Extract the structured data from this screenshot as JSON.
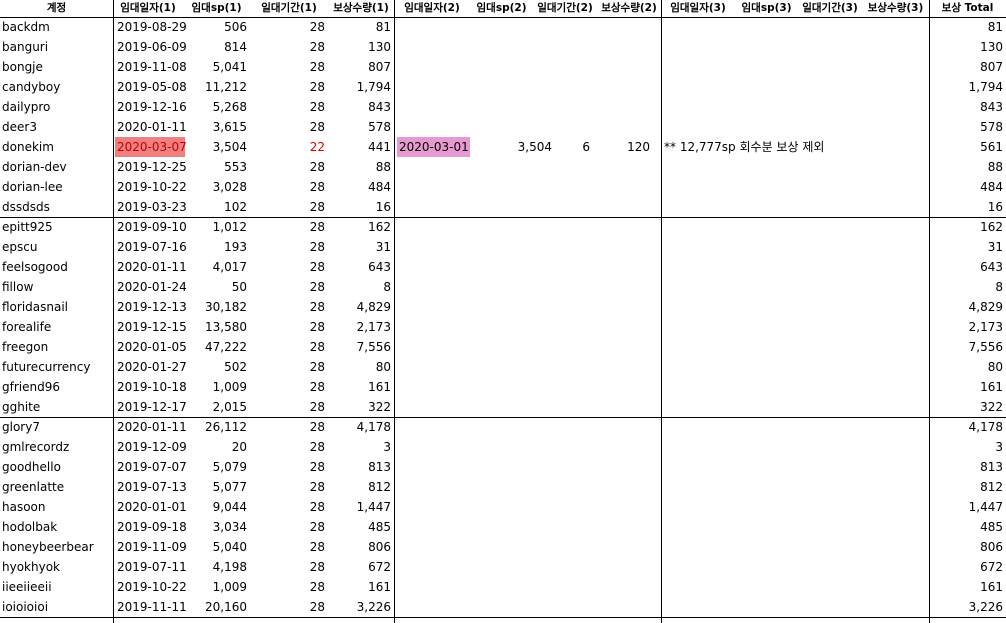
{
  "headers": [
    "계정",
    "임대일자(1)",
    "임대sp(1)",
    "일대기간(1)",
    "보상수량(1)",
    "임대일자(2)",
    "임대sp(2)",
    "일대기간(2)",
    "보상수량(2)",
    "임대일자(3)",
    "임대sp(3)",
    "일대기간(3)",
    "보상수량(3)",
    "보상 Total"
  ],
  "rows": [
    {
      "account": "backdm",
      "date1": "2019-08-29",
      "sp1": "506",
      "days1": "28",
      "reward1": "81",
      "date2": "",
      "sp2": "",
      "days2": "",
      "reward2": "",
      "note": "",
      "total": "81"
    },
    {
      "account": "banguri",
      "date1": "2019-06-09",
      "sp1": "814",
      "days1": "28",
      "reward1": "130",
      "date2": "",
      "sp2": "",
      "days2": "",
      "reward2": "",
      "note": "",
      "total": "130"
    },
    {
      "account": "bongje",
      "date1": "2019-11-08",
      "sp1": "5,041",
      "days1": "28",
      "reward1": "807",
      "date2": "",
      "sp2": "",
      "days2": "",
      "reward2": "",
      "note": "",
      "total": "807"
    },
    {
      "account": "candyboy",
      "date1": "2019-05-08",
      "sp1": "11,212",
      "days1": "28",
      "reward1": "1,794",
      "date2": "",
      "sp2": "",
      "days2": "",
      "reward2": "",
      "note": "",
      "total": "1,794"
    },
    {
      "account": "dailypro",
      "date1": "2019-12-16",
      "sp1": "5,268",
      "days1": "28",
      "reward1": "843",
      "date2": "",
      "sp2": "",
      "days2": "",
      "reward2": "",
      "note": "",
      "total": "843"
    },
    {
      "account": "deer3",
      "date1": "2020-01-11",
      "sp1": "3,615",
      "days1": "28",
      "reward1": "578",
      "date2": "",
      "sp2": "",
      "days2": "",
      "reward2": "",
      "note": "",
      "total": "578"
    },
    {
      "account": "donekim",
      "date1": "2020-03-07",
      "sp1": "3,504",
      "days1": "22",
      "reward1": "441",
      "date2": "2020-03-01",
      "sp2": "3,504",
      "days2": "6",
      "reward2": "120",
      "note": "** 12,777sp 회수분 보상 제외",
      "total": "561"
    },
    {
      "account": "dorian-dev",
      "date1": "2019-12-25",
      "sp1": "553",
      "days1": "28",
      "reward1": "88",
      "date2": "",
      "sp2": "",
      "days2": "",
      "reward2": "",
      "note": "",
      "total": "88"
    },
    {
      "account": "dorian-lee",
      "date1": "2019-10-22",
      "sp1": "3,028",
      "days1": "28",
      "reward1": "484",
      "date2": "",
      "sp2": "",
      "days2": "",
      "reward2": "",
      "note": "",
      "total": "484"
    },
    {
      "account": "dssdsds",
      "date1": "2019-03-23",
      "sp1": "102",
      "days1": "28",
      "reward1": "16",
      "date2": "",
      "sp2": "",
      "days2": "",
      "reward2": "",
      "note": "",
      "total": "16"
    },
    {
      "account": "epitt925",
      "date1": "2019-09-10",
      "sp1": "1,012",
      "days1": "28",
      "reward1": "162",
      "date2": "",
      "sp2": "",
      "days2": "",
      "reward2": "",
      "note": "",
      "total": "162"
    },
    {
      "account": "epscu",
      "date1": "2019-07-16",
      "sp1": "193",
      "days1": "28",
      "reward1": "31",
      "date2": "",
      "sp2": "",
      "days2": "",
      "reward2": "",
      "note": "",
      "total": "31"
    },
    {
      "account": "feelsogood",
      "date1": "2020-01-11",
      "sp1": "4,017",
      "days1": "28",
      "reward1": "643",
      "date2": "",
      "sp2": "",
      "days2": "",
      "reward2": "",
      "note": "",
      "total": "643"
    },
    {
      "account": "fillow",
      "date1": "2020-01-24",
      "sp1": "50",
      "days1": "28",
      "reward1": "8",
      "date2": "",
      "sp2": "",
      "days2": "",
      "reward2": "",
      "note": "",
      "total": "8"
    },
    {
      "account": "floridasnail",
      "date1": "2019-12-13",
      "sp1": "30,182",
      "days1": "28",
      "reward1": "4,829",
      "date2": "",
      "sp2": "",
      "days2": "",
      "reward2": "",
      "note": "",
      "total": "4,829"
    },
    {
      "account": "forealife",
      "date1": "2019-12-15",
      "sp1": "13,580",
      "days1": "28",
      "reward1": "2,173",
      "date2": "",
      "sp2": "",
      "days2": "",
      "reward2": "",
      "note": "",
      "total": "2,173"
    },
    {
      "account": "freegon",
      "date1": "2020-01-05",
      "sp1": "47,222",
      "days1": "28",
      "reward1": "7,556",
      "date2": "",
      "sp2": "",
      "days2": "",
      "reward2": "",
      "note": "",
      "total": "7,556"
    },
    {
      "account": "futurecurrency",
      "date1": "2020-01-27",
      "sp1": "502",
      "days1": "28",
      "reward1": "80",
      "date2": "",
      "sp2": "",
      "days2": "",
      "reward2": "",
      "note": "",
      "total": "80"
    },
    {
      "account": "gfriend96",
      "date1": "2019-10-18",
      "sp1": "1,009",
      "days1": "28",
      "reward1": "161",
      "date2": "",
      "sp2": "",
      "days2": "",
      "reward2": "",
      "note": "",
      "total": "161"
    },
    {
      "account": "gghite",
      "date1": "2019-12-17",
      "sp1": "2,015",
      "days1": "28",
      "reward1": "322",
      "date2": "",
      "sp2": "",
      "days2": "",
      "reward2": "",
      "note": "",
      "total": "322"
    },
    {
      "account": "glory7",
      "date1": "2020-01-11",
      "sp1": "26,112",
      "days1": "28",
      "reward1": "4,178",
      "date2": "",
      "sp2": "",
      "days2": "",
      "reward2": "",
      "note": "",
      "total": "4,178"
    },
    {
      "account": "gmlrecordz",
      "date1": "2019-12-09",
      "sp1": "20",
      "days1": "28",
      "reward1": "3",
      "date2": "",
      "sp2": "",
      "days2": "",
      "reward2": "",
      "note": "",
      "total": "3"
    },
    {
      "account": "goodhello",
      "date1": "2019-07-07",
      "sp1": "5,079",
      "days1": "28",
      "reward1": "813",
      "date2": "",
      "sp2": "",
      "days2": "",
      "reward2": "",
      "note": "",
      "total": "813"
    },
    {
      "account": "greenlatte",
      "date1": "2019-07-13",
      "sp1": "5,077",
      "days1": "28",
      "reward1": "812",
      "date2": "",
      "sp2": "",
      "days2": "",
      "reward2": "",
      "note": "",
      "total": "812"
    },
    {
      "account": "hasoon",
      "date1": "2020-01-01",
      "sp1": "9,044",
      "days1": "28",
      "reward1": "1,447",
      "date2": "",
      "sp2": "",
      "days2": "",
      "reward2": "",
      "note": "",
      "total": "1,447"
    },
    {
      "account": "hodolbak",
      "date1": "2019-09-18",
      "sp1": "3,034",
      "days1": "28",
      "reward1": "485",
      "date2": "",
      "sp2": "",
      "days2": "",
      "reward2": "",
      "note": "",
      "total": "485"
    },
    {
      "account": "honeybeerbear",
      "date1": "2019-11-09",
      "sp1": "5,040",
      "days1": "28",
      "reward1": "806",
      "date2": "",
      "sp2": "",
      "days2": "",
      "reward2": "",
      "note": "",
      "total": "806"
    },
    {
      "account": "hyokhyok",
      "date1": "2019-07-11",
      "sp1": "4,198",
      "days1": "28",
      "reward1": "672",
      "date2": "",
      "sp2": "",
      "days2": "",
      "reward2": "",
      "note": "",
      "total": "672"
    },
    {
      "account": "iieeiieeii",
      "date1": "2019-10-22",
      "sp1": "1,009",
      "days1": "28",
      "reward1": "161",
      "date2": "",
      "sp2": "",
      "days2": "",
      "reward2": "",
      "note": "",
      "total": "161"
    },
    {
      "account": "ioioioioi",
      "date1": "2019-11-11",
      "sp1": "20,160",
      "days1": "28",
      "reward1": "3,226",
      "date2": "",
      "sp2": "",
      "days2": "",
      "reward2": "",
      "note": "",
      "total": "3,226"
    }
  ],
  "highlights": {
    "date1_alert_color": "#f08080",
    "date2_alert_color": "#e79ad1",
    "days1_alert_text_color": "#e00000"
  }
}
